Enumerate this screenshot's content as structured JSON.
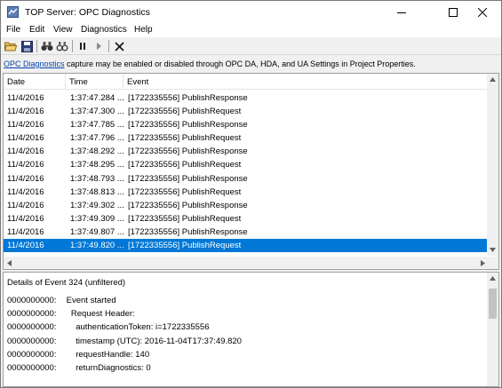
{
  "window": {
    "title": "TOP Server:  OPC Diagnostics"
  },
  "menu": [
    "File",
    "Edit",
    "View",
    "Diagnostics",
    "Help"
  ],
  "toolbar": {
    "icons": [
      "open-folder-icon",
      "save-icon",
      "find-icon",
      "find-next-icon",
      "pause-icon",
      "play-icon",
      "clear-icon"
    ]
  },
  "info": {
    "link_text": "OPC Diagnostics",
    "text": " capture may be enabled or disabled through OPC DA, HDA, and UA Settings in Project Properties."
  },
  "list": {
    "columns": [
      "Date",
      "Time",
      "Event"
    ],
    "rows": [
      {
        "date": "11/4/2016",
        "time": "1:37:47.284 ...",
        "event": "[1722335556] PublishResponse"
      },
      {
        "date": "11/4/2016",
        "time": "1:37:47.300 ...",
        "event": "[1722335556] PublishRequest"
      },
      {
        "date": "11/4/2016",
        "time": "1:37:47.785 ...",
        "event": "[1722335556] PublishResponse"
      },
      {
        "date": "11/4/2016",
        "time": "1:37:47.796 ...",
        "event": "[1722335556] PublishRequest"
      },
      {
        "date": "11/4/2016",
        "time": "1:37:48.292 ...",
        "event": "[1722335556] PublishResponse"
      },
      {
        "date": "11/4/2016",
        "time": "1:37:48.295 ...",
        "event": "[1722335556] PublishRequest"
      },
      {
        "date": "11/4/2016",
        "time": "1:37:48.793 ...",
        "event": "[1722335556] PublishResponse"
      },
      {
        "date": "11/4/2016",
        "time": "1:37:48.813 ...",
        "event": "[1722335556] PublishRequest"
      },
      {
        "date": "11/4/2016",
        "time": "1:37:49.302 ...",
        "event": "[1722335556] PublishResponse"
      },
      {
        "date": "11/4/2016",
        "time": "1:37:49.309 ...",
        "event": "[1722335556] PublishRequest"
      },
      {
        "date": "11/4/2016",
        "time": "1:37:49.807 ...",
        "event": "[1722335556] PublishResponse"
      },
      {
        "date": "11/4/2016",
        "time": "1:37:49.820 ...",
        "event": "[1722335556] PublishRequest"
      }
    ],
    "selected_index": 11
  },
  "details": {
    "title": "Details of Event 324 (unfiltered)",
    "lines": [
      {
        "prefix": "0000000000:",
        "text": " Event started"
      },
      {
        "prefix": "0000000000:",
        "text": "   Request Header:"
      },
      {
        "prefix": "0000000000:",
        "text": "     authenticationToken: i=1722335556"
      },
      {
        "prefix": "0000000000:",
        "text": "     timestamp (UTC): 2016-11-04T17:37:49.820"
      },
      {
        "prefix": "0000000000:",
        "text": "     requestHandle: 140"
      },
      {
        "prefix": "0000000000:",
        "text": "     returnDiagnostics: 0"
      }
    ]
  },
  "colors": {
    "selection": "#0078d7",
    "link": "#0645ad"
  }
}
